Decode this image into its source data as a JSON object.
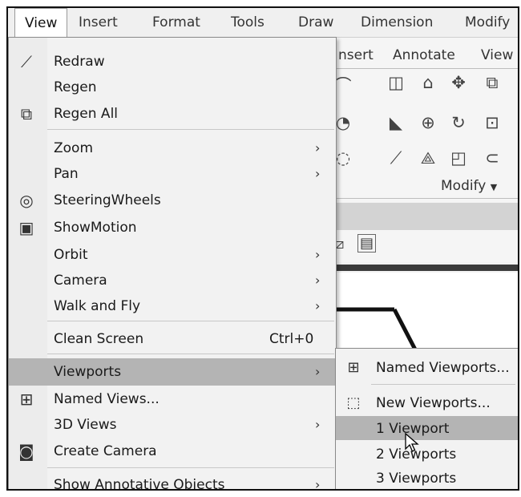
{
  "menubar": [
    "View",
    "Insert",
    "Format",
    "Tools",
    "Draw",
    "Dimension",
    "Modify"
  ],
  "ribbon": {
    "tabs": [
      "nsert",
      "Annotate",
      "View"
    ],
    "panel_label": "Modify",
    "panel_arrow": "▼"
  },
  "view_menu": {
    "items": [
      {
        "label": "Redraw",
        "icon": "redraw-icon"
      },
      {
        "label": "Regen"
      },
      {
        "label": "Regen All",
        "icon": "regen-all-icon"
      },
      {
        "label": "Zoom",
        "submenu": true
      },
      {
        "label": "Pan",
        "submenu": true
      },
      {
        "label": "SteeringWheels",
        "icon": "steering-wheel-icon"
      },
      {
        "label": "ShowMotion",
        "icon": "showmotion-icon"
      },
      {
        "label": "Orbit",
        "submenu": true
      },
      {
        "label": "Camera",
        "submenu": true
      },
      {
        "label": "Walk and Fly",
        "submenu": true
      },
      {
        "label": "Clean Screen",
        "shortcut": "Ctrl+0"
      },
      {
        "label": "Viewports",
        "submenu": true,
        "highlighted": true
      },
      {
        "label": "Named Views...",
        "icon": "named-views-icon"
      },
      {
        "label": "3D Views",
        "submenu": true
      },
      {
        "label": "Create Camera",
        "icon": "create-camera-icon"
      },
      {
        "label": "Show Annotative Objects",
        "submenu": true
      }
    ],
    "submenu_arrow": "›"
  },
  "viewports_submenu": {
    "items": [
      {
        "label": "Named Viewports...",
        "icon": "named-viewports-icon"
      },
      {
        "label": "New Viewports...",
        "icon": "new-viewports-icon"
      },
      {
        "label": "1 Viewport",
        "highlighted": true
      },
      {
        "label": "2 Viewports"
      },
      {
        "label": "3 Viewports"
      }
    ]
  }
}
